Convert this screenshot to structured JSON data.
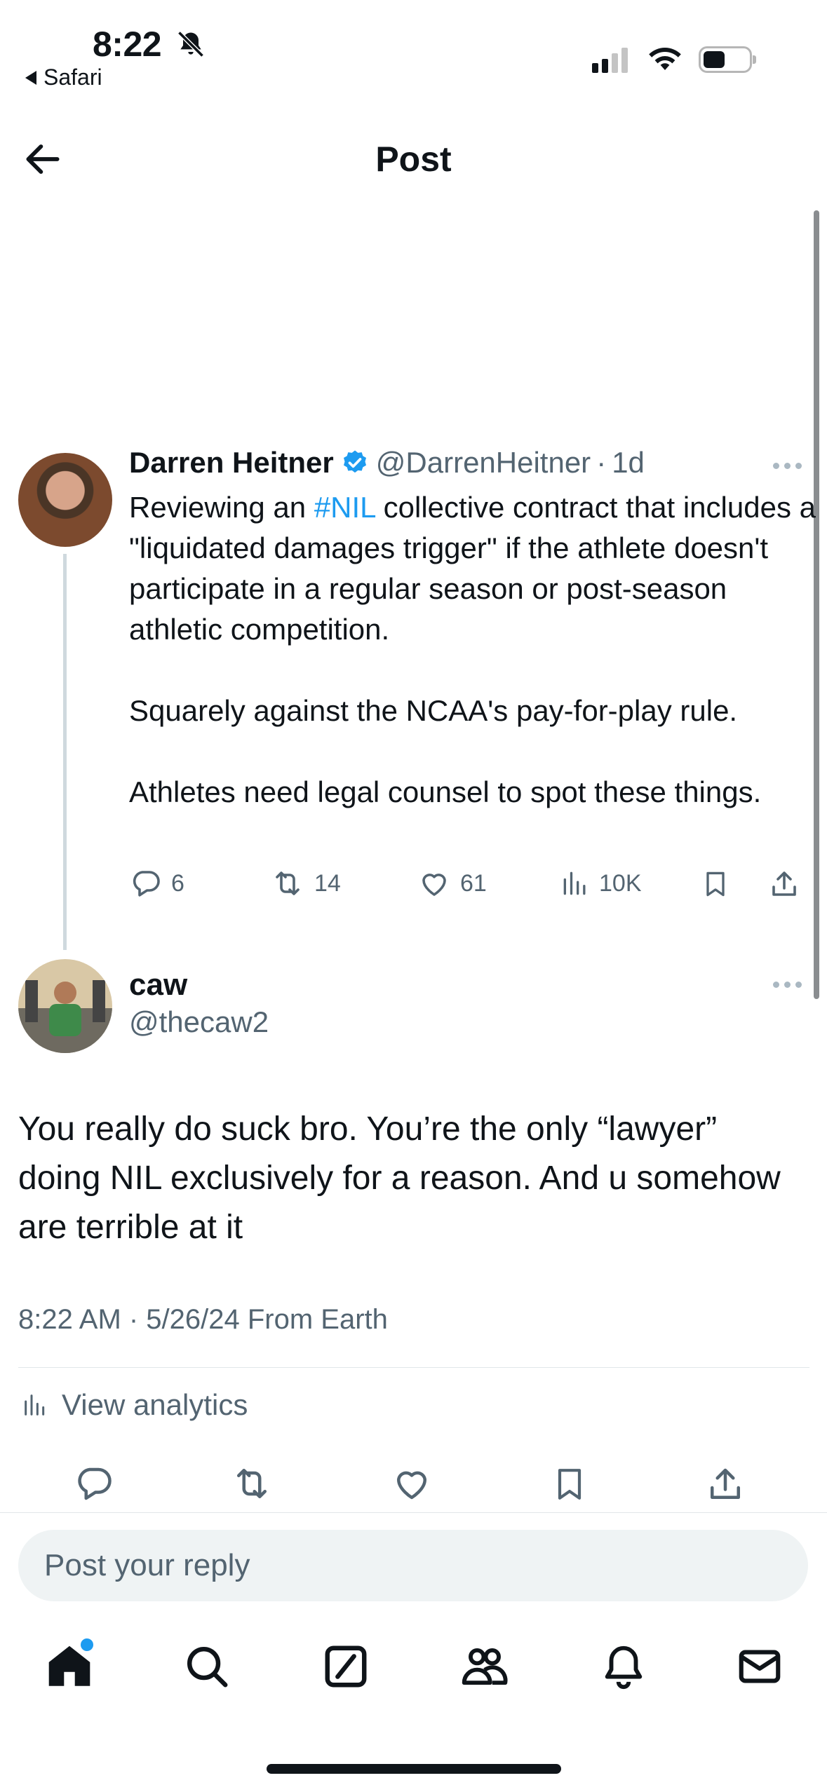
{
  "status_bar": {
    "time": "8:22",
    "back_app": "Safari"
  },
  "header": {
    "title": "Post"
  },
  "parent_post": {
    "author_name": "Darren Heitner",
    "handle": "@DarrenHeitner",
    "separator": "·",
    "age": "1d",
    "text_before_hashtag": "Reviewing an ",
    "hashtag": "#NIL",
    "text_after_hashtag": " collective contract that includes a \"liquidated damages trigger\" if the athlete doesn't participate in a regular season or post-season athletic competition.\n\nSquarely against the NCAA's pay-for-play rule.\n\nAthletes need legal counsel to spot these things.",
    "stats": {
      "replies": "6",
      "reposts": "14",
      "likes": "61",
      "views": "10K"
    }
  },
  "reply_post": {
    "author_name": "caw",
    "handle": "@thecaw2",
    "text": "You really do suck bro. You’re the only “lawyer” doing NIL exclusively for a reason. And u somehow are terrible at it",
    "timestamp": "8:22 AM · 5/26/24 From Earth",
    "analytics_label": "View analytics"
  },
  "composer": {
    "placeholder": "Post your reply"
  },
  "colors": {
    "accent": "#1d9bf0",
    "text_primary": "#0f1419",
    "text_secondary": "#536471"
  }
}
